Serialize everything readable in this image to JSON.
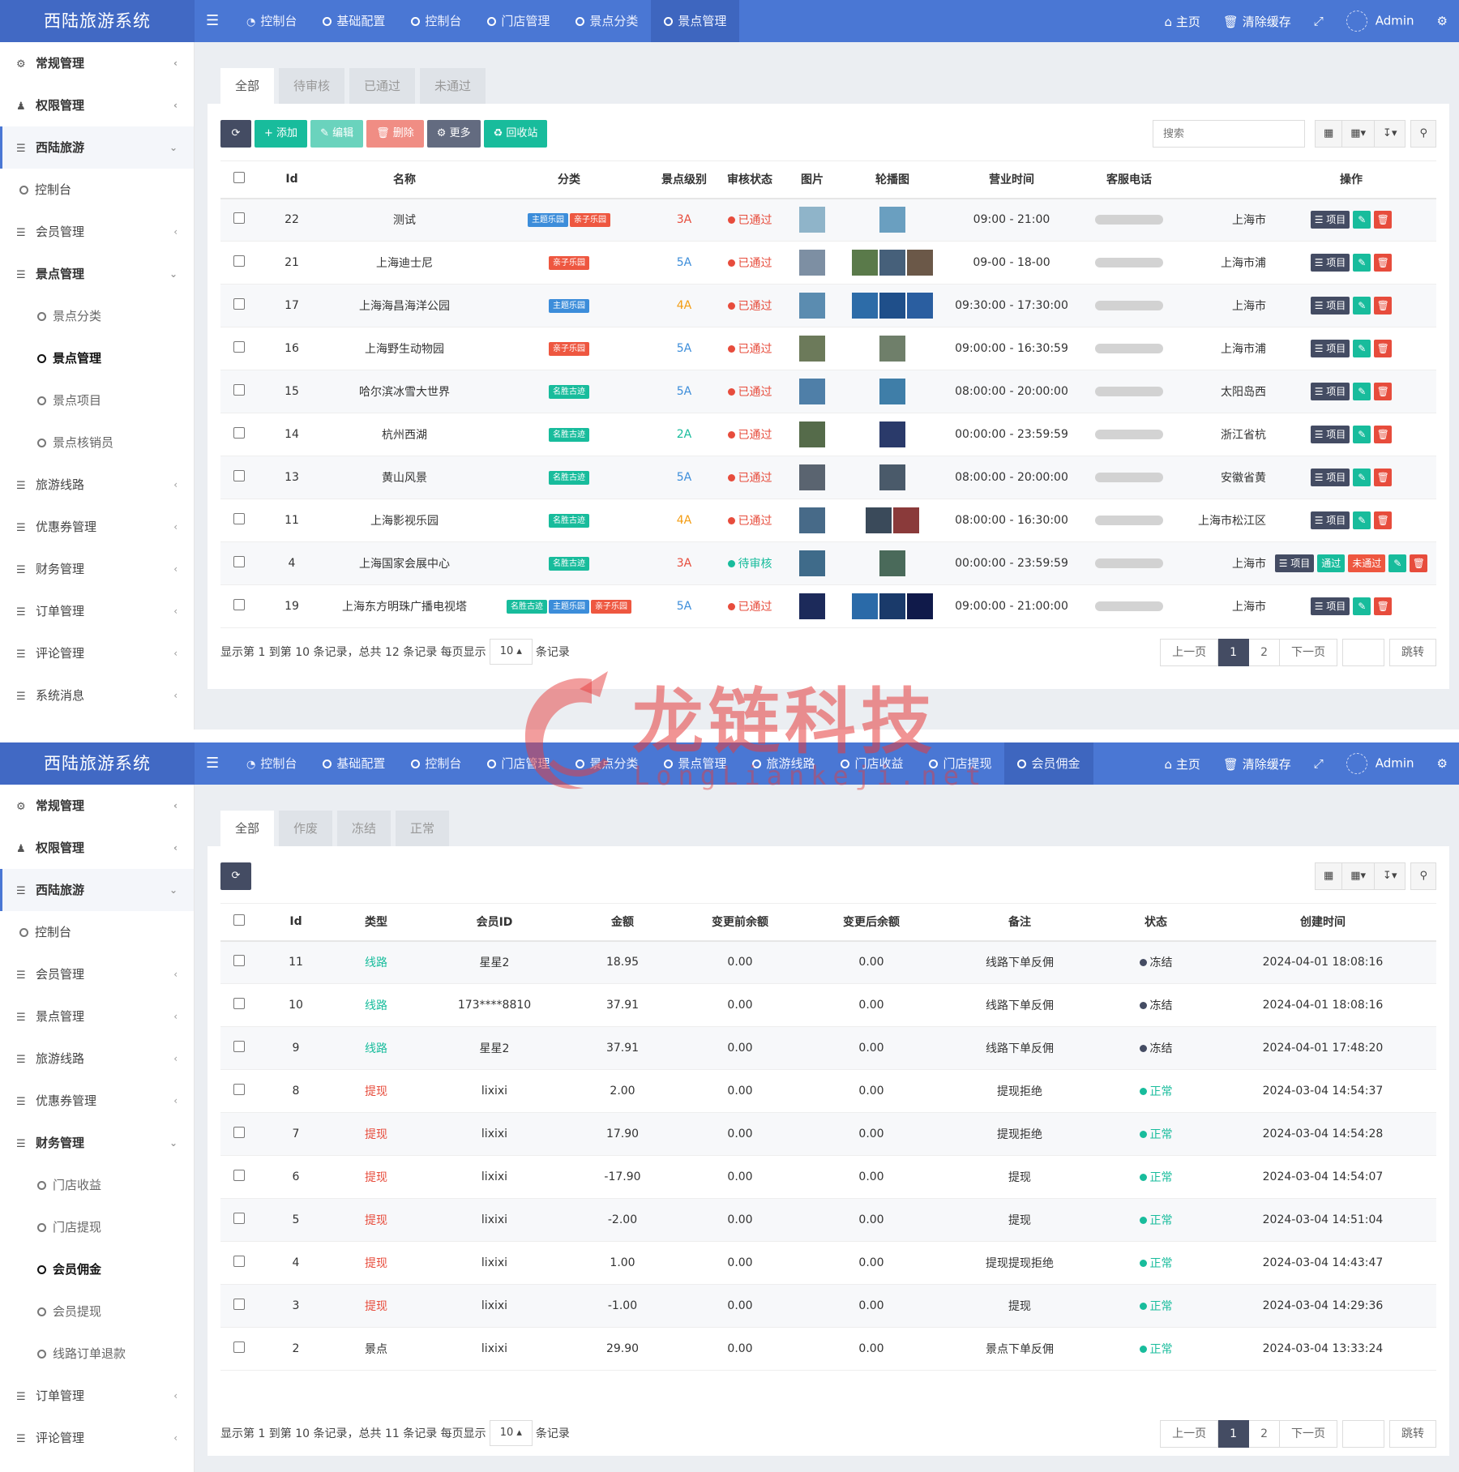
{
  "app_title": "西陆旅游系统",
  "top_right": {
    "home": "主页",
    "clear_cache": "清除缓存",
    "user": "Admin"
  },
  "shot1": {
    "nav_tabs": [
      "控制台",
      "基础配置",
      "控制台",
      "门店管理",
      "景点分类",
      "景点管理"
    ],
    "sidebar": {
      "general": "常规管理",
      "auth": "权限管理",
      "xilu": "西陆旅游",
      "dashboard": "控制台",
      "member": "会员管理",
      "spot_mgmt": "景点管理",
      "spot_cat": "景点分类",
      "spot_mgmt_sub": "景点管理",
      "spot_item": "景点项目",
      "spot_verifier": "景点核销员",
      "routes": "旅游线路",
      "coupons": "优惠券管理",
      "finance": "财务管理",
      "orders": "订单管理",
      "comments": "评论管理",
      "messages": "系统消息"
    },
    "subtabs": [
      "全部",
      "待审核",
      "已通过",
      "未通过"
    ],
    "toolbar": {
      "add": "添加",
      "edit": "编辑",
      "delete": "删除",
      "more": "更多",
      "recycle": "回收站",
      "search_placeholder": "搜索"
    },
    "columns": [
      "Id",
      "名称",
      "分类",
      "景点级别",
      "审核状态",
      "图片",
      "轮播图",
      "营业时间",
      "客服电话",
      "",
      "操作"
    ],
    "rows": [
      {
        "id": "22",
        "name": "测试",
        "tags": [
          "主题乐园",
          "亲子乐园"
        ],
        "level": "3A",
        "status": "已通过",
        "carousel": 1,
        "hours": "09:00 - 21:00",
        "addr": "上海市"
      },
      {
        "id": "21",
        "name": "上海迪士尼",
        "tags": [
          "亲子乐园"
        ],
        "level": "5A",
        "status": "已通过",
        "carousel": 3,
        "hours": "09-00 - 18-00",
        "addr": "上海市浦"
      },
      {
        "id": "17",
        "name": "上海海昌海洋公园",
        "tags": [
          "主题乐园"
        ],
        "level": "4A",
        "status": "已通过",
        "carousel": 3,
        "hours": "09:30:00 - 17:30:00",
        "addr": "上海市"
      },
      {
        "id": "16",
        "name": "上海野生动物园",
        "tags": [
          "亲子乐园"
        ],
        "level": "5A",
        "status": "已通过",
        "carousel": 1,
        "hours": "09:00:00 - 16:30:59",
        "addr": "上海市浦"
      },
      {
        "id": "15",
        "name": "哈尔滨冰雪大世界",
        "tags": [
          "名胜古迹"
        ],
        "level": "5A",
        "status": "已通过",
        "carousel": 1,
        "hours": "08:00:00 - 20:00:00",
        "addr": "太阳岛西"
      },
      {
        "id": "14",
        "name": "杭州西湖",
        "tags": [
          "名胜古迹"
        ],
        "level": "2A",
        "status": "已通过",
        "carousel": 1,
        "hours": "00:00:00 - 23:59:59",
        "addr": "浙江省杭"
      },
      {
        "id": "13",
        "name": "黄山风景",
        "tags": [
          "名胜古迹"
        ],
        "level": "5A",
        "status": "已通过",
        "carousel": 1,
        "hours": "08:00:00 - 20:00:00",
        "addr": "安徽省黄"
      },
      {
        "id": "11",
        "name": "上海影视乐园",
        "tags": [
          "名胜古迹"
        ],
        "level": "4A",
        "status": "已通过",
        "carousel": 2,
        "hours": "08:00:00 - 16:30:00",
        "addr": "上海市松江区"
      },
      {
        "id": "4",
        "name": "上海国家会展中心",
        "tags": [
          "名胜古迹"
        ],
        "level": "3A",
        "status": "待审核",
        "carousel": 1,
        "hours": "00:00:00 - 23:59:59",
        "addr": "上海市"
      },
      {
        "id": "19",
        "name": "上海东方明珠广播电视塔",
        "tags": [
          "名胜古迹",
          "主题乐园",
          "亲子乐园"
        ],
        "level": "5A",
        "status": "已通过",
        "carousel": 3,
        "hours": "09:00:00 - 21:00:00",
        "addr": "上海市"
      }
    ],
    "ops": {
      "item": "项目",
      "pass": "通过",
      "reject": "未通过"
    },
    "footer": {
      "pre": "显示第 1 到第 10 条记录，总共 12 条记录 每页显示",
      "page_size": "10",
      "post": "条记录"
    },
    "pager": {
      "prev": "上一页",
      "p1": "1",
      "p2": "2",
      "next": "下一页",
      "go": "跳转"
    }
  },
  "shot2": {
    "nav_tabs": [
      "控制台",
      "基础配置",
      "控制台",
      "门店管理",
      "景点分类",
      "景点管理",
      "旅游线路",
      "门店收益",
      "门店提现",
      "会员佣金"
    ],
    "sidebar": {
      "general": "常规管理",
      "auth": "权限管理",
      "xilu": "西陆旅游",
      "dashboard": "控制台",
      "member": "会员管理",
      "spot_mgmt": "景点管理",
      "routes": "旅游线路",
      "coupons": "优惠券管理",
      "finance": "财务管理",
      "store_income": "门店收益",
      "store_withdraw": "门店提现",
      "member_commission": "会员佣金",
      "member_withdraw": "会员提现",
      "route_refund": "线路订单退款",
      "orders": "订单管理",
      "comments": "评论管理"
    },
    "subtabs": [
      "全部",
      "作废",
      "冻结",
      "正常"
    ],
    "columns": [
      "Id",
      "类型",
      "会员ID",
      "金额",
      "变更前余额",
      "变更后余额",
      "备注",
      "状态",
      "创建时间"
    ],
    "rows": [
      {
        "id": "11",
        "type": "线路",
        "member": "星星2",
        "amount": "18.95",
        "before": "0.00",
        "after": "0.00",
        "note": "线路下单反佣",
        "status": "冻结",
        "time": "2024-04-01 18:08:16"
      },
      {
        "id": "10",
        "type": "线路",
        "member": "173****8810",
        "amount": "37.91",
        "before": "0.00",
        "after": "0.00",
        "note": "线路下单反佣",
        "status": "冻结",
        "time": "2024-04-01 18:08:16"
      },
      {
        "id": "9",
        "type": "线路",
        "member": "星星2",
        "amount": "37.91",
        "before": "0.00",
        "after": "0.00",
        "note": "线路下单反佣",
        "status": "冻结",
        "time": "2024-04-01 17:48:20"
      },
      {
        "id": "8",
        "type": "提现",
        "member": "lixixi",
        "amount": "2.00",
        "before": "0.00",
        "after": "0.00",
        "note": "提现拒绝",
        "status": "正常",
        "time": "2024-03-04 14:54:37"
      },
      {
        "id": "7",
        "type": "提现",
        "member": "lixixi",
        "amount": "17.90",
        "before": "0.00",
        "after": "0.00",
        "note": "提现拒绝",
        "status": "正常",
        "time": "2024-03-04 14:54:28"
      },
      {
        "id": "6",
        "type": "提现",
        "member": "lixixi",
        "amount": "-17.90",
        "before": "0.00",
        "after": "0.00",
        "note": "提现",
        "status": "正常",
        "time": "2024-03-04 14:54:07"
      },
      {
        "id": "5",
        "type": "提现",
        "member": "lixixi",
        "amount": "-2.00",
        "before": "0.00",
        "after": "0.00",
        "note": "提现",
        "status": "正常",
        "time": "2024-03-04 14:51:04"
      },
      {
        "id": "4",
        "type": "提现",
        "member": "lixixi",
        "amount": "1.00",
        "before": "0.00",
        "after": "0.00",
        "note": "提现提现拒绝",
        "status": "正常",
        "time": "2024-03-04 14:43:47"
      },
      {
        "id": "3",
        "type": "提现",
        "member": "lixixi",
        "amount": "-1.00",
        "before": "0.00",
        "after": "0.00",
        "note": "提现",
        "status": "正常",
        "time": "2024-03-04 14:29:36"
      },
      {
        "id": "2",
        "type": "景点",
        "member": "lixixi",
        "amount": "29.90",
        "before": "0.00",
        "after": "0.00",
        "note": "景点下单反佣",
        "status": "正常",
        "time": "2024-03-04 13:33:24"
      }
    ],
    "footer": {
      "pre": "显示第 1 到第 10 条记录，总共 11 条记录 每页显示",
      "page_size": "10",
      "post": "条记录"
    },
    "pager": {
      "prev": "上一页",
      "p1": "1",
      "p2": "2",
      "next": "下一页",
      "go": "跳转"
    }
  },
  "watermark": {
    "cn": "龙链科技",
    "en": "LongLiankeji.net"
  },
  "colors": {
    "topbar": "#4a77d4",
    "green": "#18bc9c",
    "red": "#e74c3c",
    "dark": "#444c63"
  }
}
